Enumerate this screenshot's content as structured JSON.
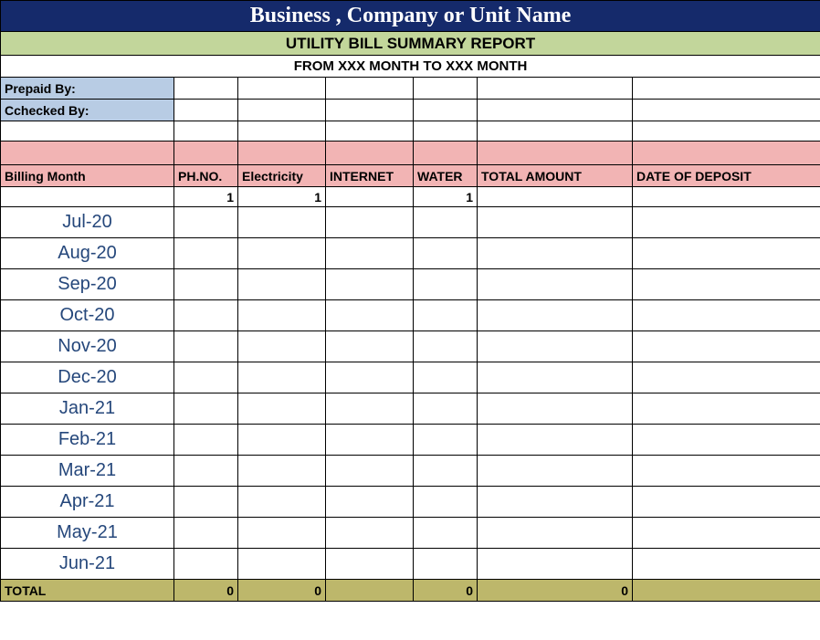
{
  "title": "Business , Company or Unit Name",
  "subtitle": "UTILITY BILL SUMMARY REPORT",
  "date_range": "FROM XXX MONTH  TO XXX MONTH",
  "prepaid_by_label": "Prepaid By:",
  "checked_by_label": "Cchecked By:",
  "prepaid_by_value": "",
  "checked_by_value": "",
  "headers": {
    "billing_month": "Billing Month",
    "ph_no": "PH.NO.",
    "electricity": "Electricity",
    "internet": "INTERNET",
    "water": "WATER",
    "total_amount": "TOTAL AMOUNT",
    "date_of_deposit": "DATE OF DEPOSIT"
  },
  "counts": {
    "ph_no": "1",
    "electricity": "1",
    "internet": "",
    "water": "1"
  },
  "months": [
    "Jul-20",
    "Aug-20",
    "Sep-20",
    "Oct-20",
    "Nov-20",
    "Dec-20",
    "Jan-21",
    "Feb-21",
    "Mar-21",
    "Apr-21",
    "May-21",
    "Jun-21"
  ],
  "totals": {
    "label": "TOTAL",
    "ph_no": "0",
    "electricity": "0",
    "internet": "",
    "water": "0",
    "total_amount": "0",
    "date_of_deposit": ""
  }
}
